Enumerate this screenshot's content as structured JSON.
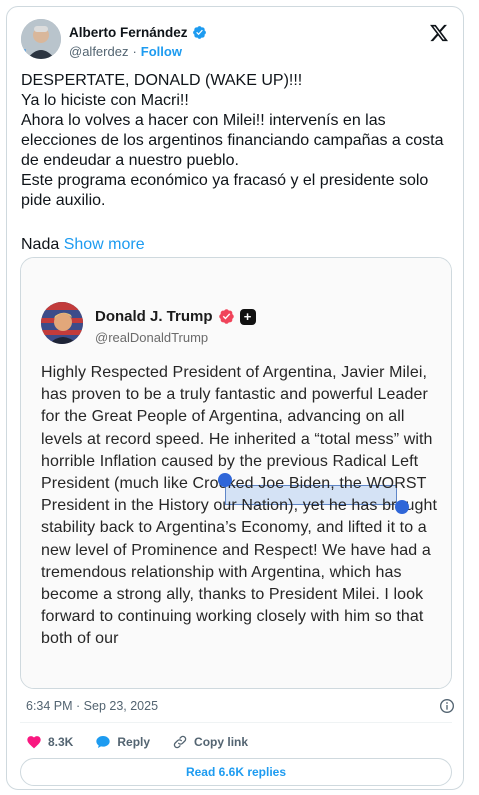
{
  "author": {
    "name": "Alberto Fernández",
    "handle": "@alferdez",
    "separator": "·",
    "follow_label": "Follow"
  },
  "tweet": {
    "text": "DESPERTATE, DONALD (WAKE UP)!!!\nYa lo hiciste con Macri!!\nAhora lo volves a hacer con Milei!! intervenís en las elecciones de los argentinos financiando campañas a costa de endeudar a nuestro pueblo.\nEste programa económico ya fracasó y el presidente solo pide auxilio.",
    "truncated_word": "Nada",
    "show_more": "Show more",
    "timestamp": "6:34 PM · Sep 23, 2025"
  },
  "embedded_post": {
    "name": "Donald J. Trump",
    "handle": "@realDonaldTrump",
    "text": "Highly Respected President of Argentina, Javier Milei, has proven to be a truly fantastic and powerful Leader for the Great People of Argentina, advancing on all levels at record speed. He inherited a “total mess” with horrible Inflation caused by the previous Radical Left President (much like Crooked Joe Biden, the WORST President in the History our Nation), yet he has brought stability back to Argentina’s Economy, and lifted it to a new level of Prominence and Respect! We have had a tremendous relationship with Argentina, which has become a strong ally, thanks to President Milei. I look forward to continuing working closely with him so that both of our",
    "selected_text": "Radical Left President"
  },
  "actions": {
    "likes": "8.3K",
    "reply": "Reply",
    "copy_link": "Copy link"
  },
  "read_replies": "Read 6.6K replies",
  "colors": {
    "accent": "#1d9bf0",
    "like_red": "#f91880",
    "text": "#0f1419",
    "muted": "#536471",
    "border": "#cfd9de"
  },
  "icons": [
    "verified-badge-icon",
    "x-logo-icon",
    "info-icon",
    "heart-icon",
    "reply-bubble-icon",
    "link-icon",
    "truth-social-plus-icon"
  ]
}
